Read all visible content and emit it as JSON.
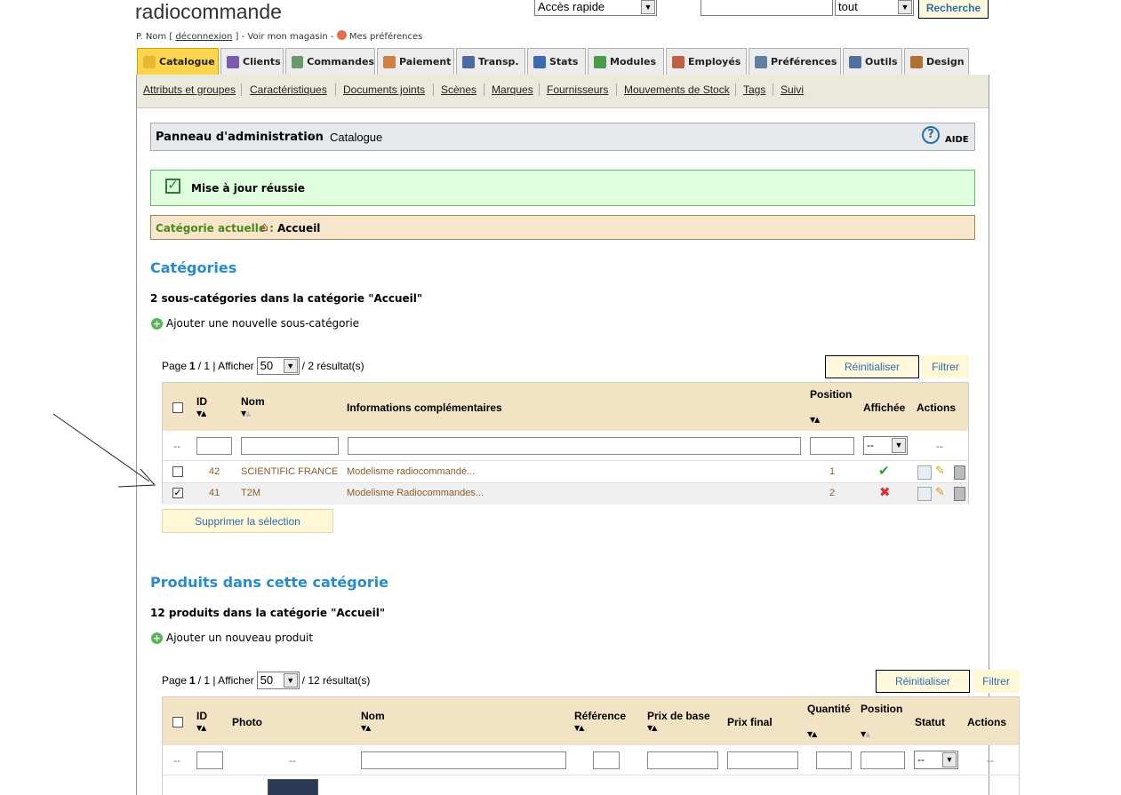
{
  "header": {
    "shop_name": "radiocommande",
    "user_prefix": "P. Nom [",
    "logout": "déconnexion",
    "user_mid": "] - Voir mon magasin -",
    "prefs": "Mes préférences",
    "quick_access": "Accès rapide",
    "search_scope": "tout",
    "search_button": "Recherche",
    "search_value": ""
  },
  "tabs": [
    {
      "label": "Catalogue",
      "icon": "folder-icon"
    },
    {
      "label": "Clients",
      "icon": "user-icon"
    },
    {
      "label": "Commandes",
      "icon": "cart-icon"
    },
    {
      "label": "Paiement",
      "icon": "payment-icon"
    },
    {
      "label": "Transp.",
      "icon": "truck-icon"
    },
    {
      "label": "Stats",
      "icon": "chart-icon"
    },
    {
      "label": "Modules",
      "icon": "puzzle-icon"
    },
    {
      "label": "Employés",
      "icon": "employee-icon"
    },
    {
      "label": "Préférences",
      "icon": "pref-icon"
    },
    {
      "label": "Outils",
      "icon": "wrench-icon"
    },
    {
      "label": "Design",
      "icon": "palette-icon"
    }
  ],
  "subnav": [
    "Attributs et groupes",
    "Caractéristiques",
    "Documents joints",
    "Scènes",
    "Marques",
    "Fournisseurs",
    "Mouvements de Stock",
    "Tags",
    "Suivi"
  ],
  "breadcrumb": {
    "root": "Panneau d'administration",
    "current": "Catalogue",
    "help": "AIDE"
  },
  "success_msg": "Mise à jour réussie",
  "current_category": {
    "label": "Catégorie actuelle :",
    "value": "Accueil"
  },
  "categories": {
    "title": "Catégories",
    "count_text": "2 sous-catégories dans la catégorie \"Accueil\"",
    "add_link": "Ajouter une nouvelle sous-catégorie",
    "pager": {
      "page_label": "Page",
      "page": "1",
      "sep": "/ 1 | Afficher",
      "per_page": "50",
      "results": "/ 2 résultat(s)"
    },
    "reset": "Réinitialiser",
    "filter": "Filtrer",
    "columns": {
      "id": "ID",
      "name": "Nom",
      "info": "Informations complémentaires",
      "position": "Position",
      "shown": "Affichée",
      "actions": "Actions"
    },
    "filter_row": {
      "dash": "--",
      "select": "--",
      "actions_dash": "--"
    },
    "rows": [
      {
        "id": "42",
        "name": "SCIENTIFIC FRANCE",
        "info": "Modelisme radiocommandé...",
        "position": "1",
        "shown": true,
        "checked": false
      },
      {
        "id": "41",
        "name": "T2M",
        "info": "Modelisme Radiocommandes...",
        "position": "2",
        "shown": false,
        "checked": true
      }
    ],
    "delete_selection": "Supprimer la sélection"
  },
  "products": {
    "title": "Produits dans cette catégorie",
    "count_text": "12 produits dans la catégorie \"Accueil\"",
    "add_link": "Ajouter un nouveau produit",
    "pager": {
      "page_label": "Page",
      "page": "1",
      "sep": "/ 1 | Afficher",
      "per_page": "50",
      "results": "/ 12 résultat(s)"
    },
    "reset": "Réinitialiser",
    "filter": "Filtrer",
    "columns": {
      "id": "ID",
      "photo": "Photo",
      "name": "Nom",
      "reference": "Référence",
      "base_price": "Prix de base",
      "final_price": "Prix final",
      "quantity": "Quantité",
      "position": "Position",
      "status": "Statut",
      "actions": "Actions"
    },
    "filter_row": {
      "dash": "--",
      "photo_dash": "--",
      "select": "--",
      "actions_dash": "--"
    }
  },
  "colors": {
    "accent": "#268ccd",
    "tab_active": "#ffd54f",
    "header_bg": "#f2e3c5",
    "row_text": "#8b5a2b"
  }
}
